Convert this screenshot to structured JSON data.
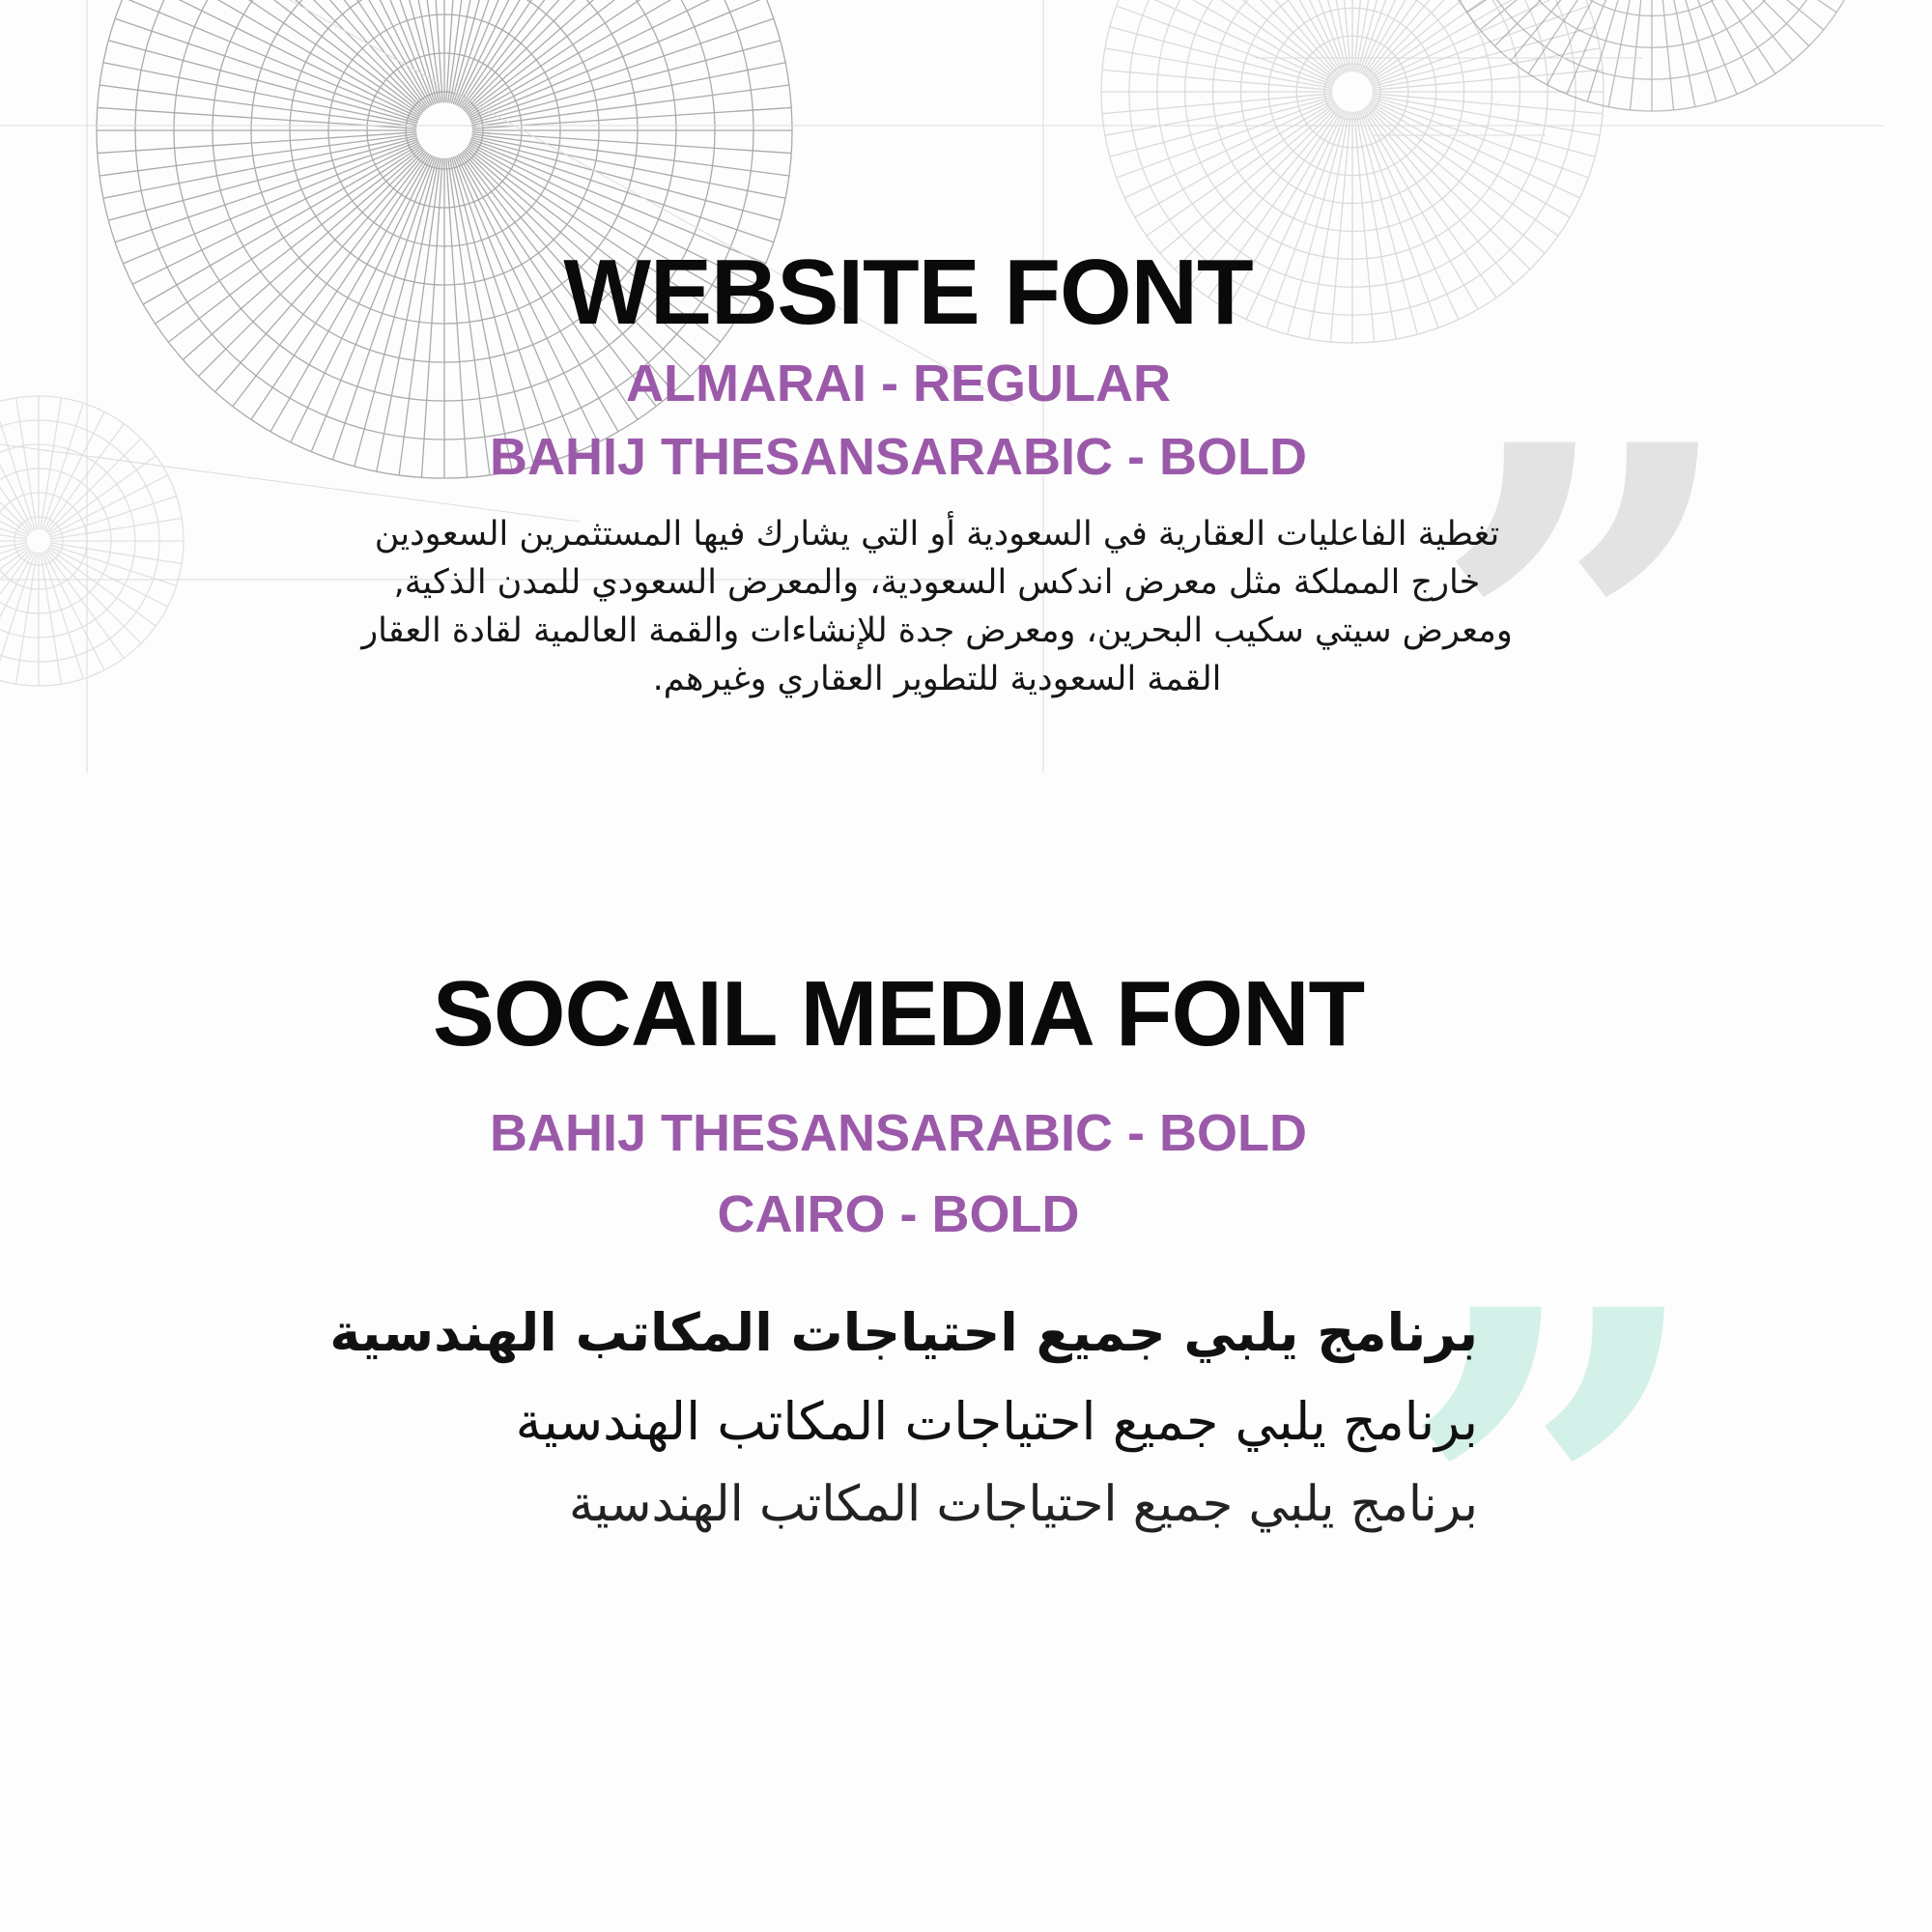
{
  "website": {
    "title": "WEBSITE FONT",
    "fonts": [
      "ALMARAI - REGULAR",
      "BAHIJ THESANSARABIC - BOLD"
    ],
    "sample_paragraph": "تغطية الفاعليات العقارية في السعودية أو التي يشارك فيها المستثمرين السعودين خارج المملكة مثل معرض اندكس السعودية، والمعرض السعودي للمدن الذكية, ومعرض سيتي سكيب البحرين، ومعرض جدة للإنشاءات والقمة العالمية لقادة العقار القمة السعودية للتطوير العقاري وغيرهم."
  },
  "social": {
    "title": "SOCAIL MEDIA FONT",
    "fonts": [
      "BAHIJ THESANSARABIC - BOLD",
      "CAIRO - BOLD"
    ],
    "samples": [
      "برنامج يلبي جميع احتياجات المكاتب الهندسية",
      "برنامج يلبي جميع احتياجات المكاتب الهندسية",
      "برنامج يلبي جميع احتياجات المكاتب الهندسية"
    ]
  },
  "decor": {
    "quote_glyph": "”",
    "quote_colors": [
      "#e3e3e3",
      "#d3f0e9"
    ],
    "accent_color": "#9b5aa9"
  }
}
